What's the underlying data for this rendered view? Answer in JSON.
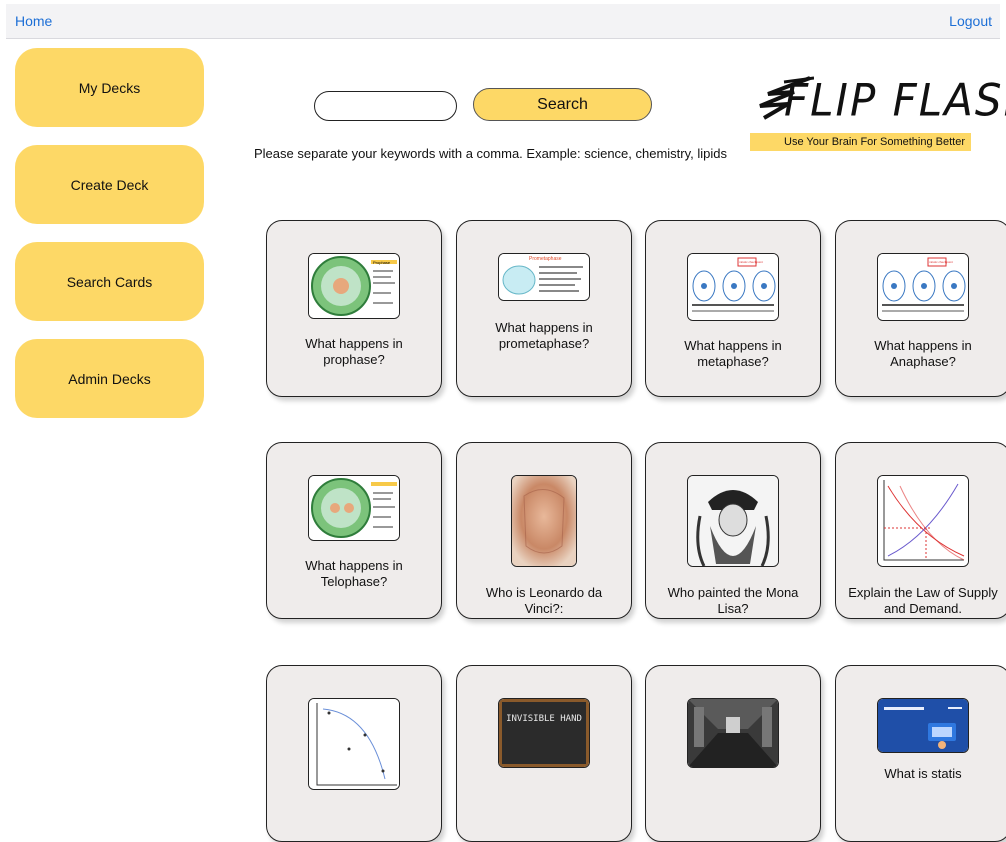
{
  "nav": {
    "home": "Home",
    "logout": "Logout"
  },
  "sidebar": [
    {
      "label": "My Decks"
    },
    {
      "label": "Create Deck"
    },
    {
      "label": "Search Cards"
    },
    {
      "label": "Admin Decks"
    }
  ],
  "search": {
    "value": "",
    "button": "Search",
    "hint": "Please separate your keywords with a comma. Example: science, chemistry, lipids"
  },
  "logo": {
    "title": "FLIP FLASH",
    "tagline": "Use Your Brain For Something Better"
  },
  "thumbnail_text": {
    "prophase": "Prophase",
    "prometaphase": "Prometaphase",
    "spindle_checkpoint": "mitotic checkpoint",
    "invisible_hand": "INVISIBLE HAND"
  },
  "cards": [
    {
      "question": "What happens in prophase?"
    },
    {
      "question": "What happens in prometaphase?"
    },
    {
      "question": "What happens in metaphase?"
    },
    {
      "question": "What happens in Anaphase?"
    },
    {
      "question": "What happens in Telophase?"
    },
    {
      "question": "Who is Leonardo da Vinci?:"
    },
    {
      "question": "Who painted the Mona Lisa?"
    },
    {
      "question": "Explain the Law of Supply and Demand."
    },
    {
      "question": ""
    },
    {
      "question": ""
    },
    {
      "question": ""
    },
    {
      "question": "What is statis"
    }
  ]
}
